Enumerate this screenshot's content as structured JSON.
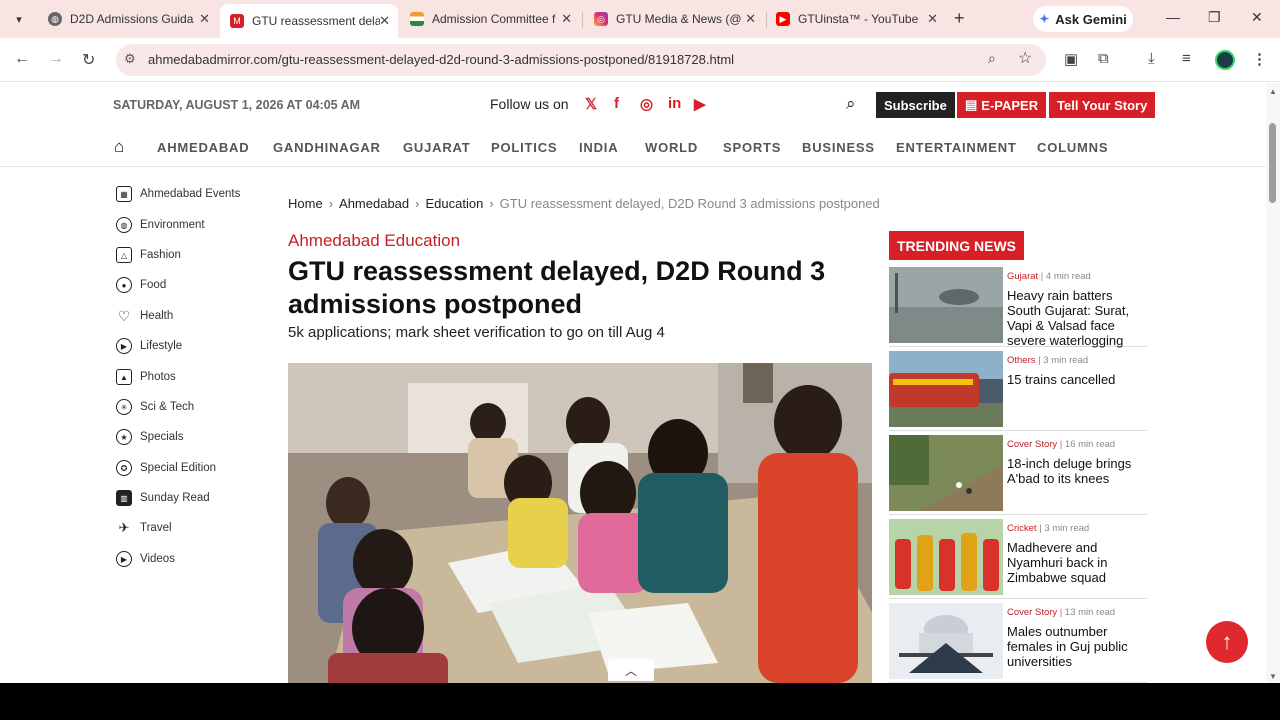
{
  "browser": {
    "tabs": [
      {
        "title": "D2D Admissions Guida",
        "active": false
      },
      {
        "title": "GTU reassessment dela",
        "active": true
      },
      {
        "title": "Admission Committee f",
        "active": false
      },
      {
        "title": "GTU Media & News (@",
        "active": false
      },
      {
        "title": "GTUinsta™ - YouTube",
        "active": false
      }
    ],
    "ask_gemini": "Ask Gemini",
    "url": "ahmedabadmirror.com/gtu-reassessment-delayed-d2d-round-3-admissions-postponed/81918728.html",
    "colors": {
      "tab_strip": "#f9e4e4",
      "omnibox": "#f8e8e8"
    }
  },
  "header": {
    "date": "SATURDAY, AUGUST 1, 2026 AT 04:05 AM",
    "follow_label": "Follow us on",
    "social": [
      "x-icon",
      "facebook-icon",
      "instagram-icon",
      "linkedin-icon",
      "youtube-icon"
    ],
    "subscribe": "Subscribe",
    "epaper": "E-PAPER",
    "tell_story": "Tell Your Story",
    "brand_red": "#d61f26"
  },
  "nav": [
    "AHMEDABAD",
    "GANDHINAGAR",
    "GUJARAT",
    "POLITICS",
    "INDIA",
    "WORLD",
    "SPORTS",
    "BUSINESS",
    "ENTERTAINMENT",
    "COLUMNS"
  ],
  "sidebar": [
    "Ahmedabad Events",
    "Environment",
    "Fashion",
    "Food",
    "Health",
    "Lifestyle",
    "Photos",
    "Sci & Tech",
    "Specials",
    "Special Edition",
    "Sunday Read",
    "Travel",
    "Videos"
  ],
  "breadcrumb": {
    "home": "Home",
    "city": "Ahmedabad",
    "category": "Education",
    "current": "GTU reassessment delayed, D2D Round 3 admissions postponed"
  },
  "article": {
    "section": "Ahmedabad Education",
    "headline": "GTU reassessment delayed, D2D Round 3 admissions postponed",
    "subhead": "5k applications; mark sheet verification to go on till Aug 4"
  },
  "trending": {
    "heading": "TRENDING NEWS",
    "items": [
      {
        "cat": "Gujarat",
        "read": "4 min read",
        "title": "Heavy rain batters South Gujarat: Surat, Vapi & Valsad face severe waterlogging"
      },
      {
        "cat": "Others",
        "read": "3 min read",
        "title": "15 trains cancelled"
      },
      {
        "cat": "Cover Story",
        "read": "16 min read",
        "title": "18-inch deluge brings A'bad to its knees"
      },
      {
        "cat": "Cricket",
        "read": "3 min read",
        "title": "Madhevere and Nyamhuri back in Zimbabwe squad"
      },
      {
        "cat": "Cover Story",
        "read": "13 min read",
        "title": "Males outnumber females in Guj public universities"
      }
    ]
  }
}
